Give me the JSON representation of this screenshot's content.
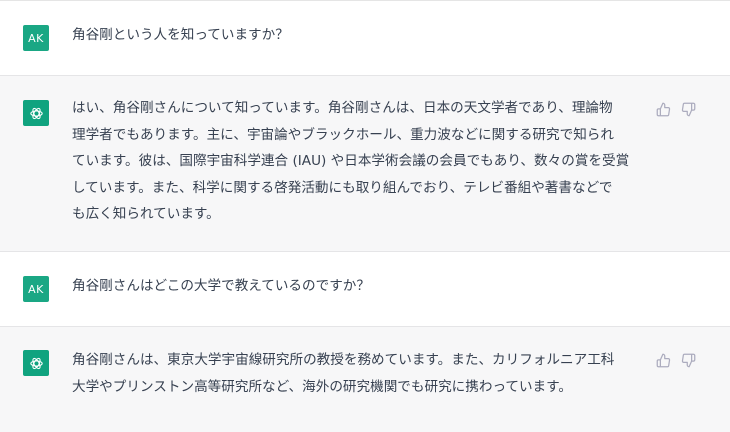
{
  "messages": [
    {
      "role": "user",
      "avatar_label": "AK",
      "text": "角谷剛という人を知っていますか？"
    },
    {
      "role": "assistant",
      "lines": [
        "はい、角谷剛さんについて知っています。角谷剛さんは、日本の天文学者であり、理論物",
        "理学者でもあります。主に、宇宙論やブラックホール、重力波などに関する研究で知られ",
        "ています。彼は、国際宇宙科学連合 (IAU) や日本学術会議の会員でもあり、数々の賞を受賞",
        "しています。また、科学に関する啓発活動にも取り組んでおり、テレビ番組や著書などで",
        "も広く知られています。"
      ],
      "icons": [
        "openai-logo",
        "thumbs-up",
        "thumbs-down"
      ]
    },
    {
      "role": "user",
      "avatar_label": "AK",
      "text": "角谷剛さんはどこの大学で教えているのですか？"
    },
    {
      "role": "assistant",
      "lines": [
        "角谷剛さんは、東京大学宇宙線研究所の教授を務めています。また、カリフォルニア工科",
        "大学やプリンストン高等研究所など、海外の研究機関でも研究に携わっています。"
      ],
      "icons": [
        "openai-logo",
        "thumbs-up",
        "thumbs-down"
      ]
    }
  ],
  "colors": {
    "user_bg": "#ffffff",
    "assistant_bg": "#f7f7f8",
    "avatar_green": "#10a37f",
    "text": "#374151",
    "icon": "#acacbe"
  }
}
